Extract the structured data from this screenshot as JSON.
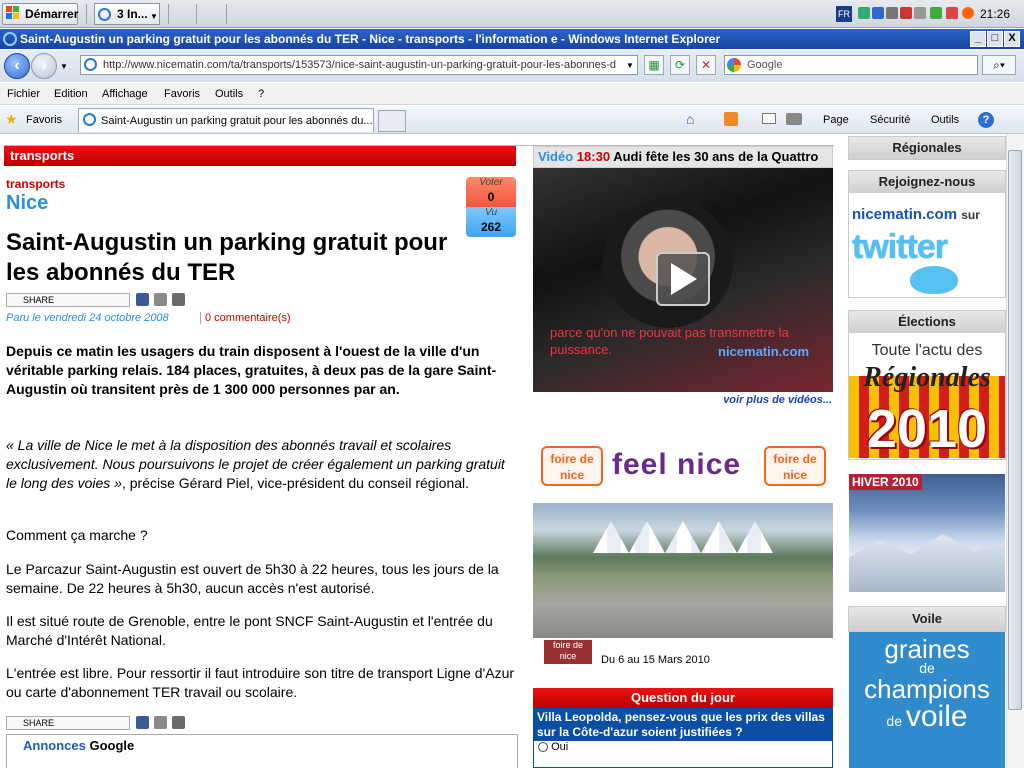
{
  "taskbar": {
    "start_label": "Démarrer",
    "ie_task_label": "3 In...",
    "lang": "FR",
    "clock": "21:26"
  },
  "window": {
    "title": "Saint-Augustin un parking gratuit pour les abonnés du TER - Nice - transports - l'information e - Windows Internet Explorer",
    "min": "_",
    "max": "□",
    "close": "X"
  },
  "address": {
    "url": "http://www.nicematin.com/ta/transports/153573/nice-saint-augustin-un-parking-gratuit-pour-les-abonnes-d",
    "search_placeholder": "Google"
  },
  "menu": [
    "Fichier",
    "Edition",
    "Affichage",
    "Favoris",
    "Outils",
    "?"
  ],
  "favorites_label": "Favoris",
  "tab_title": "Saint-Augustin un parking gratuit pour les abonnés du...",
  "commandbar": {
    "page": "Page",
    "security": "Sécurité",
    "tools": "Outils"
  },
  "article": {
    "section": "transports",
    "category": "transports",
    "city": "Nice",
    "vote_label": "Voter",
    "vote_count": "0",
    "seen_label": "Vu",
    "seen_count": "262",
    "headline": "Saint-Augustin un parking gratuit pour les abonnés du TER",
    "share_label": "SHARE",
    "date": "Paru le vendredi 24 octobre 2008",
    "comments": "0 commentaire(s)",
    "lede": "Depuis ce matin les usagers du train disposent à l'ouest de la ville d'un véritable parking relais. 184 places, gratuites, à deux pas de la gare Saint-Augustin où transitent près de 1 300 000 personnes par an.",
    "quote": "« La ville de Nice le met à la disposition des abonnés travail et scolaires exclusivement. Nous poursuivons le projet de créer également un parking gratuit le long des voies »",
    "quote_attrib": ", précise Gérard Piel, vice-président du conseil régional.",
    "p1": "Comment ça marche ?",
    "p2": "Le Parcazur Saint-Augustin est ouvert de 5h30 à 22 heures, tous les jours de la semaine. De 22 heures à 5h30, aucun accès n'est autorisé.",
    "p3": "Il est situé route de Grenoble, entre le pont SNCF Saint-Augustin et l'entrée du Marché d'Intérêt National.",
    "p4": "L'entrée est libre. Pour ressortir il faut introduire son titre de transport Ligne d'Azur ou carte d'abonnement TER travail ou scolaire.",
    "annonces": "Annonces",
    "annonces_google": "Google"
  },
  "video": {
    "prefix": "Vidéo",
    "time": "18:30",
    "title": "Audi fête les 30 ans de la Quattro",
    "subtitle": "parce qu'on ne pouvait pas transmettre la puissance.",
    "logo": "nicematin.com",
    "more": "voir plus de vidéos..."
  },
  "fair": {
    "badge": "foire de nice",
    "feel": "feel nice",
    "thumb": "foire de nice",
    "dates": "Du 6 au 15 Mars 2010"
  },
  "question": {
    "header": "Question du jour",
    "text": "Villa Leopolda, pensez-vous que les prix des villas sur la Côte-d'azur soient justifiées ?",
    "answer": "Oui"
  },
  "right": {
    "regionales": "Régionales",
    "join": "Rejoignez-nous",
    "nicematin": "nicematin.com",
    "sur": "sur",
    "twitter": "twitter",
    "elections": "Élections",
    "elections_line1": "Toute l'actu des",
    "elections_line2": "Régionales",
    "elections_year": "2010",
    "hiver": "HIVER 2010",
    "voile": "Voile",
    "voile_l1": "graines",
    "voile_l2": "de",
    "voile_l3": "champions",
    "voile_l4": "de",
    "voile_l5": "voile"
  }
}
